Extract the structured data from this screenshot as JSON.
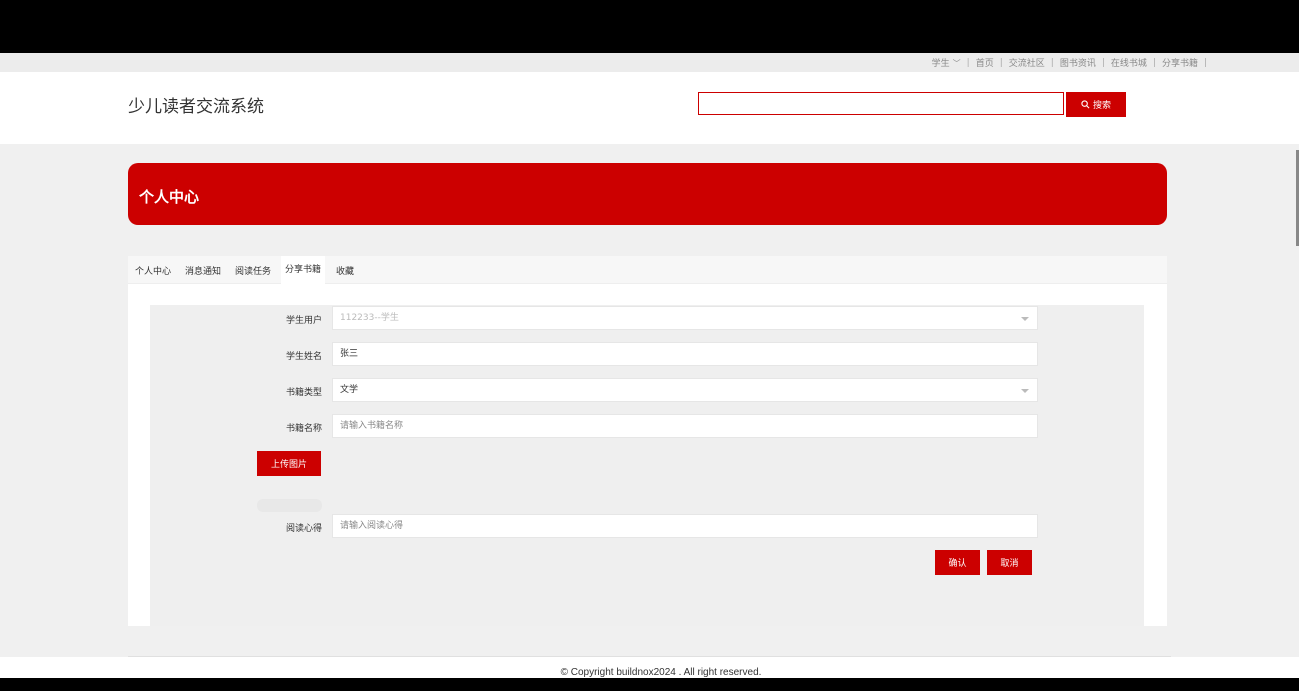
{
  "topnav": {
    "user": "学生",
    "links": [
      "首页",
      "交流社区",
      "图书资讯",
      "在线书城",
      "分享书籍"
    ]
  },
  "header": {
    "logo": "少儿读者交流系统",
    "search_button": "搜索"
  },
  "banner": {
    "title": "个人中心"
  },
  "tabs": [
    "个人中心",
    "消息通知",
    "阅读任务",
    "分享书籍",
    "收藏"
  ],
  "form": {
    "student_user": {
      "label": "学生用户",
      "value": "112233--学生"
    },
    "student_name": {
      "label": "学生姓名",
      "value": "张三"
    },
    "book_type": {
      "label": "书籍类型",
      "value": "文学"
    },
    "book_name": {
      "label": "书籍名称",
      "placeholder": "请输入书籍名称"
    },
    "upload_button": "上传图片",
    "reading_notes": {
      "label": "阅读心得",
      "placeholder": "请输入阅读心得"
    },
    "confirm_button": "确认",
    "cancel_button": "取消"
  },
  "footer": {
    "copyright": "© Copyright buildnox2024 . All right reserved."
  },
  "colors": {
    "brand_red": "#cc0000"
  }
}
